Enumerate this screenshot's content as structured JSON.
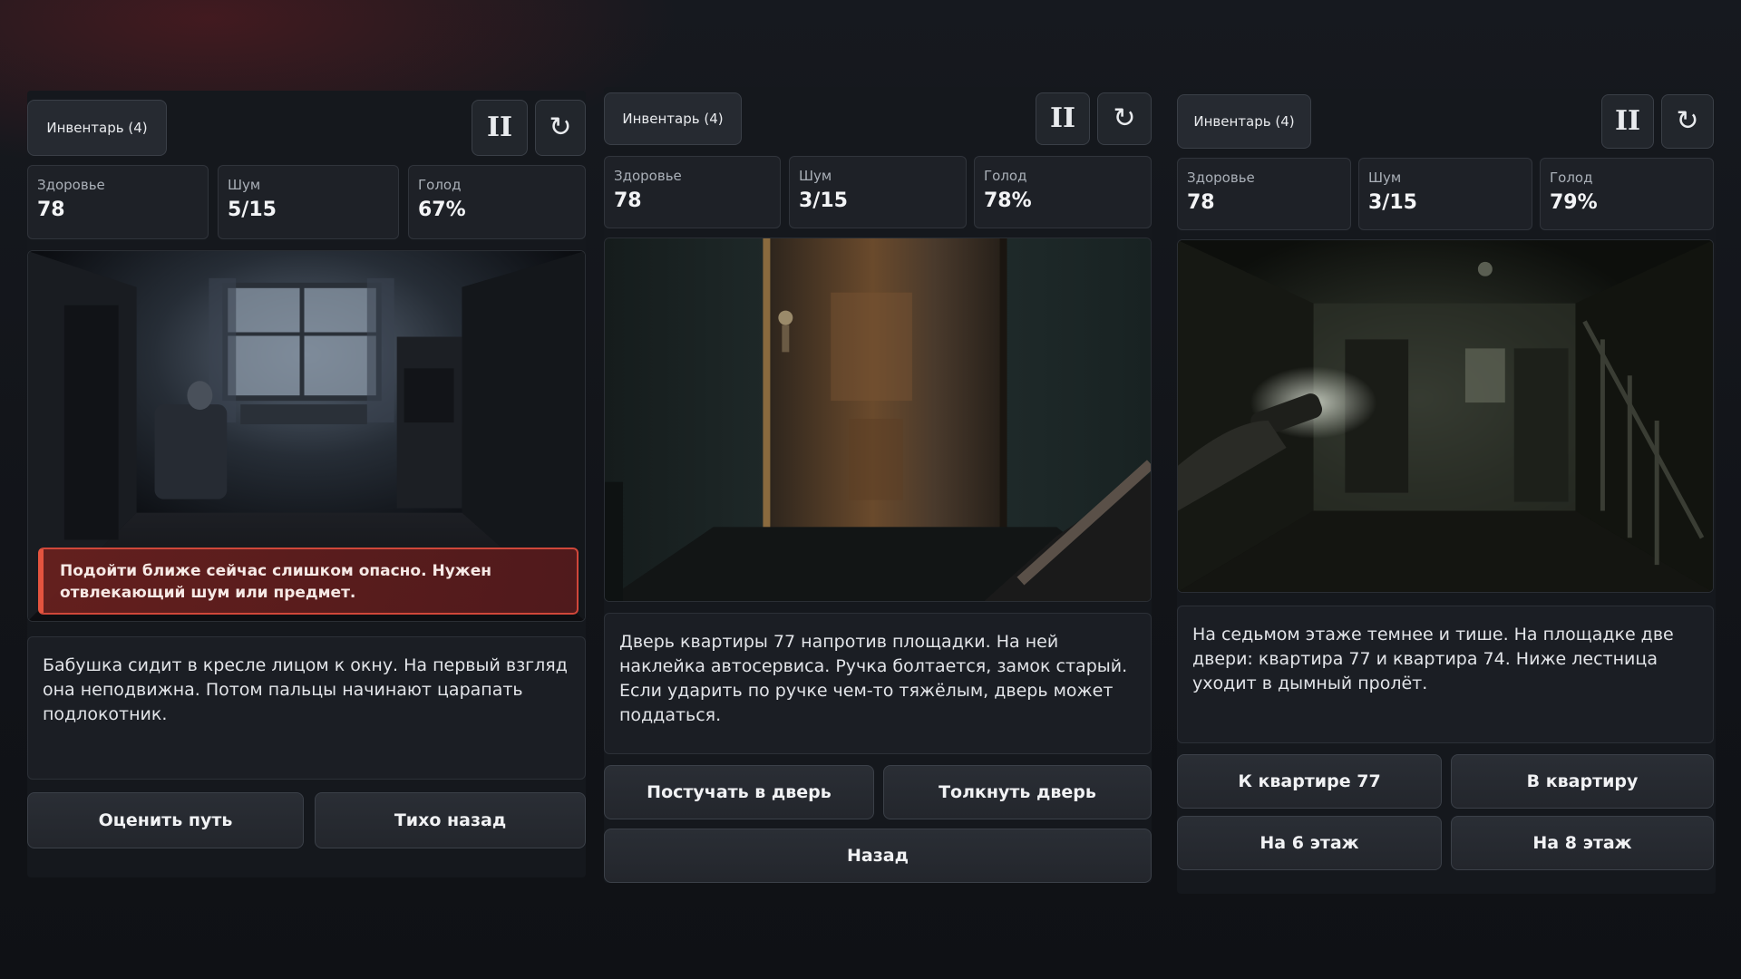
{
  "colors": {
    "background": "#121419",
    "panel": "#15181d",
    "button": "#262a31",
    "warning_border": "#d0473a",
    "warning_fill": "#68201e",
    "text": "#e6e8eb"
  },
  "icons": {
    "pause": "pause-icon",
    "restart": "restart-icon"
  },
  "panels": [
    {
      "inventory_label": "Инвентарь (4)",
      "stats": [
        {
          "label": "Здоровье",
          "value": "78"
        },
        {
          "label": "Шум",
          "value": "5/15"
        },
        {
          "label": "Голод",
          "value": "67%"
        }
      ],
      "warning": "Подойти ближе сейчас слишком опасно. Нужен отвлекающий шум или предмет.",
      "description": "Бабушка сидит в кресле лицом к окну. На первый взгляд она неподвижна. Потом пальцы начинают царапать подлокотник.",
      "actions": [
        "Оценить путь",
        "Тихо назад"
      ]
    },
    {
      "inventory_label": "Инвентарь (4)",
      "stats": [
        {
          "label": "Здоровье",
          "value": "78"
        },
        {
          "label": "Шум",
          "value": "3/15"
        },
        {
          "label": "Голод",
          "value": "78%"
        }
      ],
      "description": "Дверь квартиры 77 напротив площадки. На ней наклейка автосервиса. Ручка болтается, замок старый. Если ударить по ручке чем-то тяжёлым, дверь может поддаться.",
      "actions": [
        "Постучать в дверь",
        "Толкнуть дверь",
        "Назад"
      ]
    },
    {
      "inventory_label": "Инвентарь (4)",
      "stats": [
        {
          "label": "Здоровье",
          "value": "78"
        },
        {
          "label": "Шум",
          "value": "3/15"
        },
        {
          "label": "Голод",
          "value": "79%"
        }
      ],
      "description": "На седьмом этаже темнее и тише. На площадке две двери: квартира 77 и квартира 74. Ниже лестница уходит в дымный пролёт.",
      "actions": [
        "К квартире 77",
        "В квартиру",
        "На 6 этаж",
        "На 8 этаж"
      ]
    }
  ]
}
